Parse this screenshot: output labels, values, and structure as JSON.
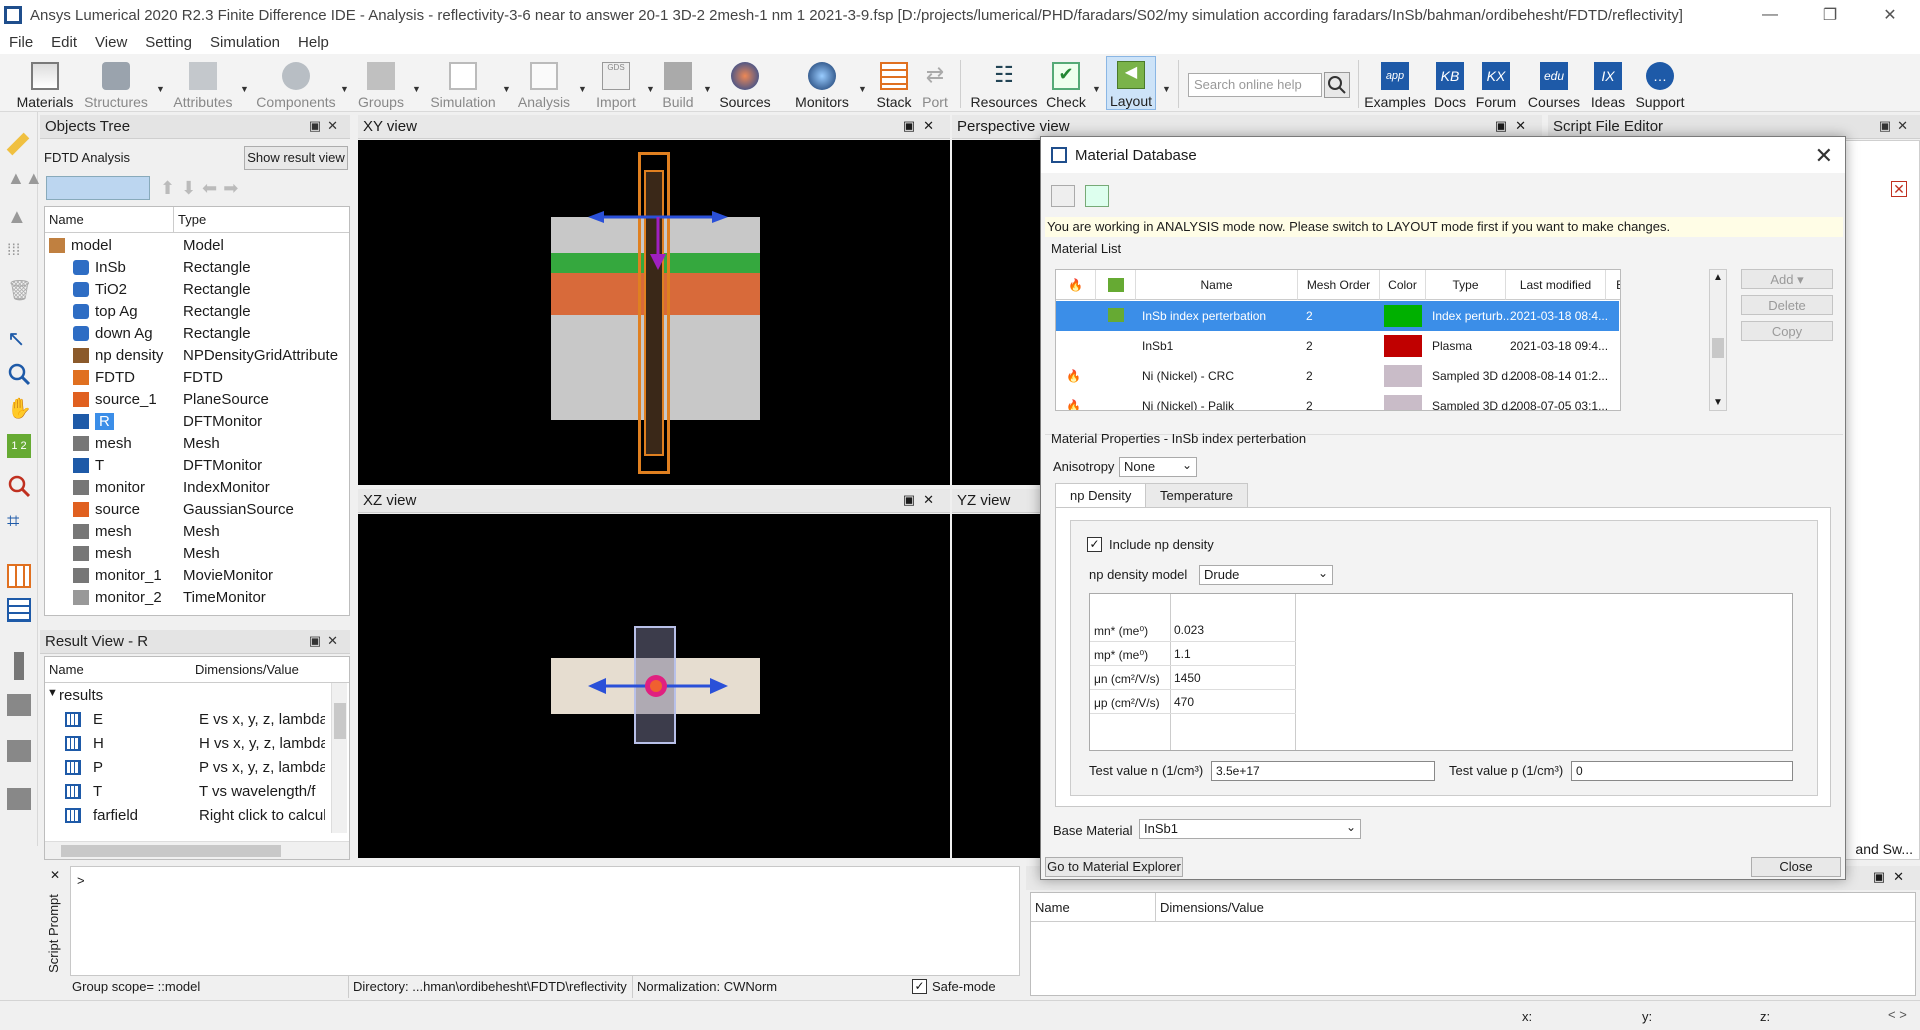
{
  "window": {
    "title": "Ansys Lumerical 2020 R2.3 Finite Difference IDE - Analysis - reflectivity-3-6 near to answer 20-1 3D-2 2mesh-1 nm 1 2021-3-9.fsp [D:/projects/lumerical/PHD/faradars/S02/my simulation according  faradars/InSb/bahman/ordibehesht/FDTD/reflectivity]"
  },
  "menu": [
    "File",
    "Edit",
    "View",
    "Setting",
    "Simulation",
    "Help"
  ],
  "toolbar": {
    "materials": "Materials",
    "structures": "Structures",
    "attributes": "Attributes",
    "components": "Components",
    "groups": "Groups",
    "simulation": "Simulation",
    "analysis": "Analysis",
    "import": "Import",
    "build": "Build",
    "sources": "Sources",
    "monitors": "Monitors",
    "stack": "Stack",
    "port": "Port",
    "resources": "Resources",
    "check": "Check",
    "layout": "Layout",
    "search_placeholder": "Search online help",
    "examples": "Examples",
    "docs": "Docs",
    "forum": "Forum",
    "courses": "Courses",
    "ideas": "Ideas",
    "support": "Support"
  },
  "objects_tree": {
    "title": "Objects Tree",
    "mode_label": "FDTD Analysis",
    "show_result_btn": "Show result view",
    "col_name": "Name",
    "col_type": "Type",
    "root": {
      "name": "model",
      "type": "Model"
    },
    "items": [
      {
        "name": "InSb",
        "type": "Rectangle"
      },
      {
        "name": "TiO2",
        "type": "Rectangle"
      },
      {
        "name": "top Ag",
        "type": "Rectangle"
      },
      {
        "name": "down Ag",
        "type": "Rectangle"
      },
      {
        "name": "np density",
        "type": "NPDensityGridAttribute"
      },
      {
        "name": "FDTD",
        "type": "FDTD"
      },
      {
        "name": "source_1",
        "type": "PlaneSource"
      },
      {
        "name": "R",
        "type": "DFTMonitor"
      },
      {
        "name": "mesh",
        "type": "Mesh"
      },
      {
        "name": "T",
        "type": "DFTMonitor"
      },
      {
        "name": "monitor",
        "type": "IndexMonitor"
      },
      {
        "name": "source",
        "type": "GaussianSource"
      },
      {
        "name": "mesh",
        "type": "Mesh"
      },
      {
        "name": "mesh",
        "type": "Mesh"
      },
      {
        "name": "monitor_1",
        "type": "MovieMonitor"
      },
      {
        "name": "monitor_2",
        "type": "TimeMonitor"
      }
    ]
  },
  "result_view": {
    "title": "Result View - R",
    "col_name": "Name",
    "col_dims": "Dimensions/Value",
    "group": "results",
    "items": [
      {
        "name": "E",
        "value": "E vs x, y, z, lambda/"
      },
      {
        "name": "H",
        "value": "H vs x, y, z, lambda/"
      },
      {
        "name": "P",
        "value": "P vs x, y, z, lambda/"
      },
      {
        "name": "T",
        "value": "T vs wavelength/f"
      },
      {
        "name": "farfield",
        "value": "Right click to calcul"
      }
    ]
  },
  "views": {
    "xy": "XY view",
    "xz": "XZ view",
    "perspective": "Perspective view",
    "yz": "YZ view",
    "script_editor": "Script File Editor",
    "script_right": "and Sw..."
  },
  "script_prompt": {
    "label": "Script Prompt",
    "prompt": ">"
  },
  "bottom_status": {
    "group_scope": "Group scope= ::model",
    "directory": "Directory: ...hman\\ordibehesht\\FDTD\\reflectivity",
    "normalization": "Normalization: CWNorm",
    "safe_mode": "Safe-mode"
  },
  "bottom_right_table": {
    "col_name": "Name",
    "col_dims": "Dimensions/Value"
  },
  "status": {
    "x": "x:",
    "y": "y:",
    "z": "z:"
  },
  "dialog": {
    "title": "Material Database",
    "warning": "You are working in ANALYSIS mode now. Please switch to LAYOUT mode first if you want to make changes.",
    "material_list_label": "Material List",
    "headers": {
      "name": "Name",
      "mesh": "Mesh Order",
      "color": "Color",
      "type": "Type",
      "modified": "Last modified",
      "export": "Export"
    },
    "materials": [
      {
        "name": "InSb index perterbation",
        "mesh": "2",
        "color": "#00b000",
        "type": "Index perturb...",
        "modified": "2021-03-18 08:4...",
        "export": true
      },
      {
        "name": "InSb1",
        "mesh": "2",
        "color": "#c00000",
        "type": "Plasma",
        "modified": "2021-03-18 09:4...",
        "export": true
      },
      {
        "name": "Ni (Nickel) - CRC",
        "mesh": "2",
        "color": "#c9bcc8",
        "type": "Sampled 3D d...",
        "modified": "2008-08-14 01:2...",
        "export": true
      },
      {
        "name": "Ni (Nickel) - Palik",
        "mesh": "2",
        "color": "#c9bcc8",
        "type": "Sampled 3D d...",
        "modified": "2008-07-05 03:1...",
        "export": true
      }
    ],
    "buttons": {
      "add": "Add",
      "delete": "Delete",
      "copy": "Copy",
      "close": "Close",
      "explorer": "Go to Material Explorer"
    },
    "properties_label": "Material Properties - InSb index perterbation",
    "anisotropy_label": "Anisotropy",
    "anisotropy_value": "None",
    "tabs": [
      "np Density",
      "Temperature"
    ],
    "include_np": "Include np density",
    "np_model_label": "np density model",
    "np_model_value": "Drude",
    "params": [
      {
        "label": "mn* (me⁰)",
        "value": "0.023"
      },
      {
        "label": "mp* (me⁰)",
        "value": "1.1"
      },
      {
        "label": "μn (cm²/V/s)",
        "value": "1450"
      },
      {
        "label": "μp (cm²/V/s)",
        "value": "470"
      }
    ],
    "test_n_label": "Test value n (1/cm³)",
    "test_n_value": "3.5e+17",
    "test_p_label": "Test value p (1/cm³)",
    "test_p_value": "0",
    "base_label": "Base Material",
    "base_value": "InSb1"
  }
}
